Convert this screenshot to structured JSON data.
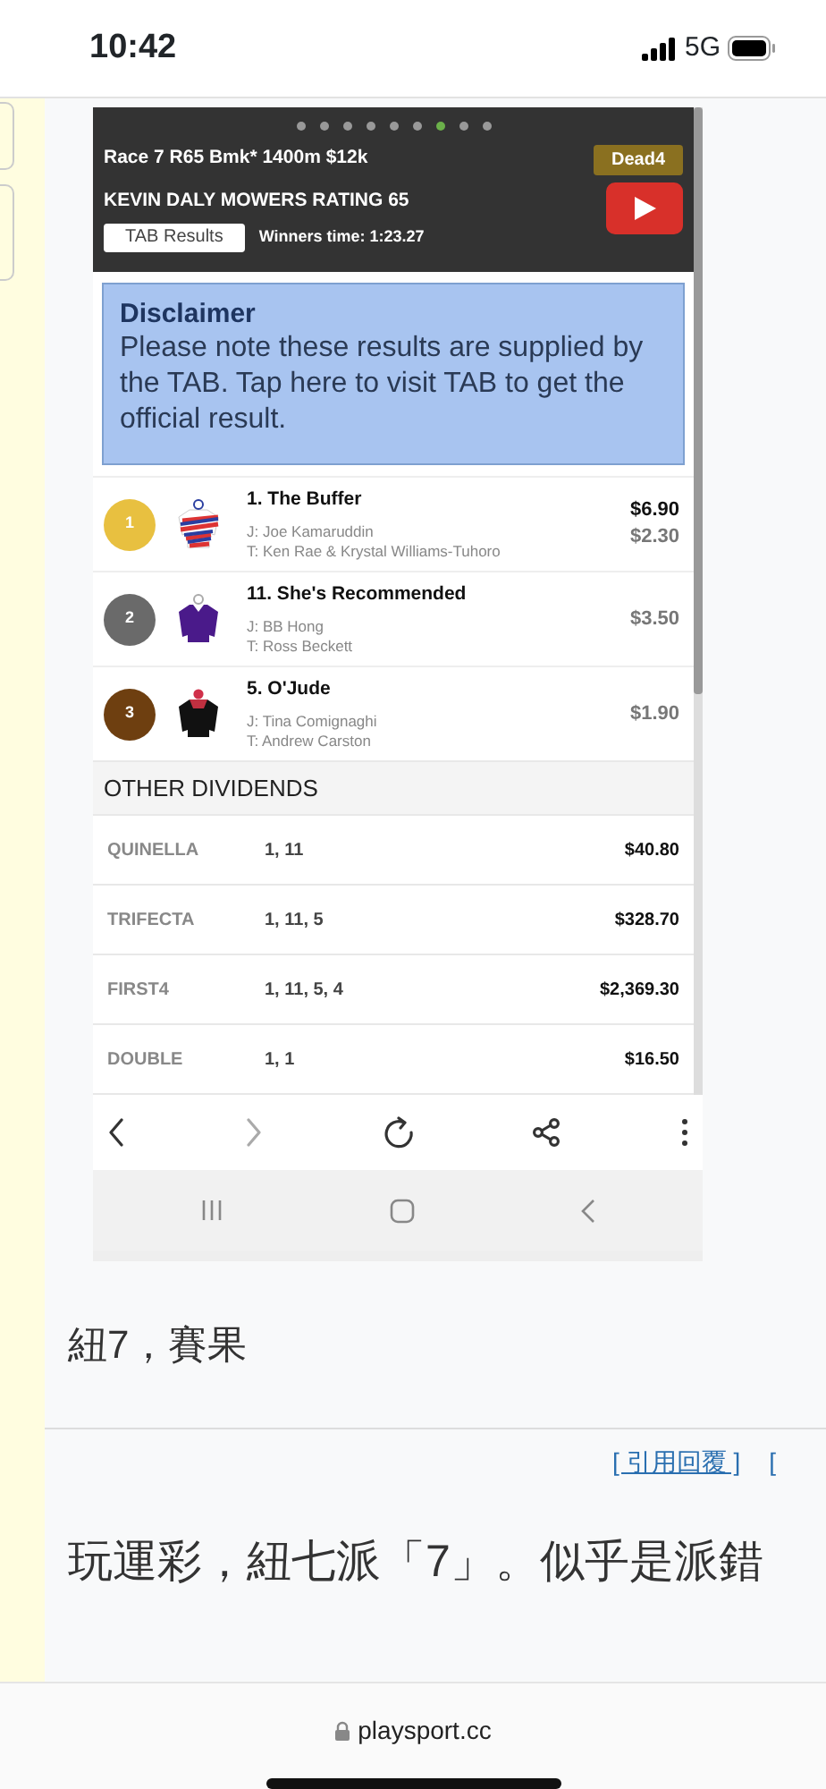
{
  "status_bar": {
    "time": "10:42",
    "network": "5G"
  },
  "race": {
    "pager": [
      {
        "selected": false
      },
      {
        "selected": false
      },
      {
        "selected": false
      },
      {
        "selected": false
      },
      {
        "selected": false
      },
      {
        "selected": false
      },
      {
        "selected": true
      },
      {
        "selected": false
      },
      {
        "selected": false
      }
    ],
    "title": "Race 7 R65 Bmk* 1400m $12k",
    "status": "Dead4",
    "name": "KEVIN DALY MOWERS RATING 65",
    "tab_button": "TAB Results",
    "winners_time": "Winners time: 1:23.27",
    "disclaimer": {
      "title": "Disclaimer",
      "text": "Please note these results are supplied by the TAB. Tap here to visit TAB to get the official result."
    },
    "runners": [
      {
        "place": "1",
        "color": "#e8c040",
        "horse": "1. The Buffer",
        "jockey": "J: Joe Kamaruddin",
        "trainer": "T: Ken Rae & Krystal Williams-Tuhoro",
        "win": "$6.90",
        "place_div": "$2.30"
      },
      {
        "place": "2",
        "color": "#6a6a6a",
        "horse": "11. She's Recommended",
        "jockey": "J: BB Hong",
        "trainer": "T: Ross Beckett",
        "place_div": "$3.50"
      },
      {
        "place": "3",
        "color": "#6e3f10",
        "horse": "5. O'Jude",
        "jockey": "J: Tina Comignaghi",
        "trainer": "T: Andrew Carston",
        "place_div": "$1.90"
      }
    ],
    "other_title": "OTHER DIVIDENDS",
    "dividends": [
      {
        "type": "QUINELLA",
        "runners": "1, 11",
        "amount": "$40.80"
      },
      {
        "type": "TRIFECTA",
        "runners": "1, 11, 5",
        "amount": "$328.70"
      },
      {
        "type": "FIRST4",
        "runners": "1, 11, 5, 4",
        "amount": "$2,369.30"
      },
      {
        "type": "DOUBLE",
        "runners": "1, 1",
        "amount": "$16.50"
      }
    ]
  },
  "caption": "紐7，賽果",
  "post": {
    "links": [
      "[ 引用回覆 ]",
      "["
    ],
    "text": "玩運彩，紐七派「7」。似乎是派錯"
  },
  "footer": {
    "url": "playsport.cc"
  }
}
